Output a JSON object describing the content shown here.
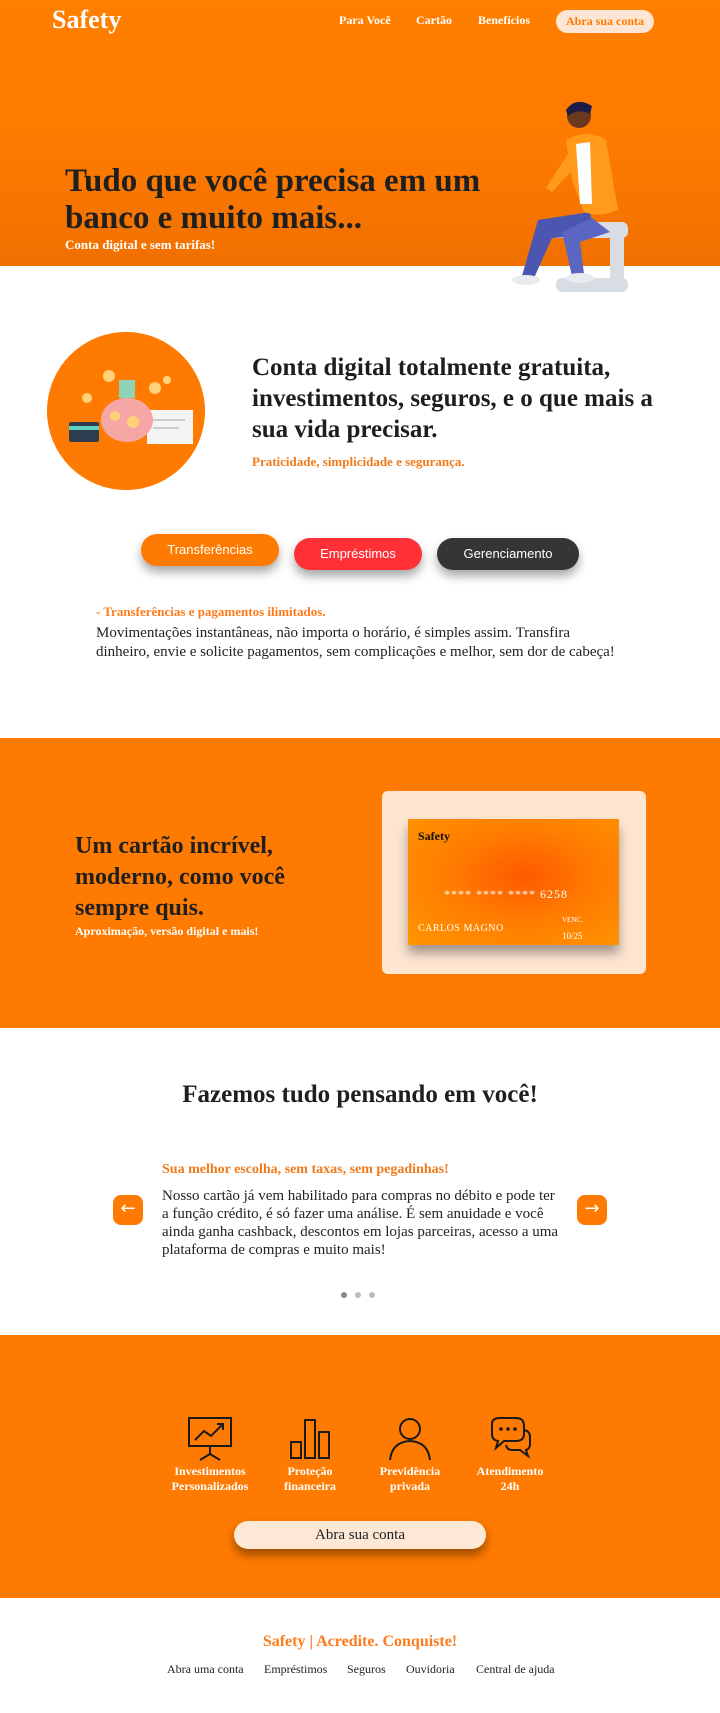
{
  "header": {
    "logo": "Safety",
    "nav": [
      "Para Você",
      "Cartão",
      "Benefícios"
    ],
    "cta": "Abra sua conta"
  },
  "hero": {
    "title": "Tudo que você precisa em um banco e muito mais...",
    "subtitle": "Conta digital e sem tarifas!"
  },
  "intro": {
    "title": "Conta digital totalmente gratuita, investimentos, seguros, e o que mais a sua vida precisar.",
    "subtitle": "Praticidade, simplicidade e segurança."
  },
  "tabs": [
    {
      "label": "Transferências",
      "active": true
    },
    {
      "label": "Empréstimos",
      "active": false
    },
    {
      "label": "Gerenciamento",
      "active": false
    }
  ],
  "tab_content": {
    "heading": "- Transferências e pagamentos ilimitados.",
    "text": "Movimentações instantâneas, não importa o horário, é simples assim. Transfira dinheiro, envie e solicite pagamentos, sem complicações e melhor, sem dor de cabeça!"
  },
  "card_section": {
    "title": "Um cartão incrível, moderno, como você sempre quis.",
    "subtitle": "Aproximação, versão digital e mais!",
    "card": {
      "brand": "Safety",
      "number": "**** **** ****  6258",
      "holder": "CARLOS MAGNO",
      "venc_label": "VENC.",
      "expiry": "10/25"
    }
  },
  "carousel": {
    "title": "Fazemos tudo pensando em você!",
    "prev": "←",
    "next": "→",
    "slide_heading": "Sua melhor escolha, sem taxas, sem pegadinhas!",
    "slide_text": "Nosso cartão já vem habilitado para compras no débito e pode ter a função crédito, é só fazer uma análise. É sem anuidade e você ainda ganha cashback, descontos em lojas parceiras, acesso a uma plataforma de compras e muito mais!",
    "active_index": 0,
    "slide_count": 3
  },
  "benefits": {
    "items": [
      {
        "label_1": "Investimentos",
        "label_2": "Personalizados",
        "icon": "investment-chart-icon"
      },
      {
        "label_1": "Proteção",
        "label_2": "financeira",
        "icon": "bar-chart-icon"
      },
      {
        "label_1": "Previdência",
        "label_2": "privada",
        "icon": "person-icon"
      },
      {
        "label_1": "Atendimento",
        "label_2": "24h",
        "icon": "chat-bubbles-icon"
      }
    ],
    "cta": "Abra sua conta"
  },
  "footer": {
    "title": "Safety | Acredite. Conquiste!",
    "links": [
      "Abra uma conta",
      "Empréstimos",
      "Seguros",
      "Ouvidoria",
      "Central de ajuda"
    ]
  },
  "colors": {
    "brand_orange": "#ff7a00",
    "loan_red": "#ff3136",
    "manage_dark": "#353535",
    "cream": "#fde6d4"
  }
}
